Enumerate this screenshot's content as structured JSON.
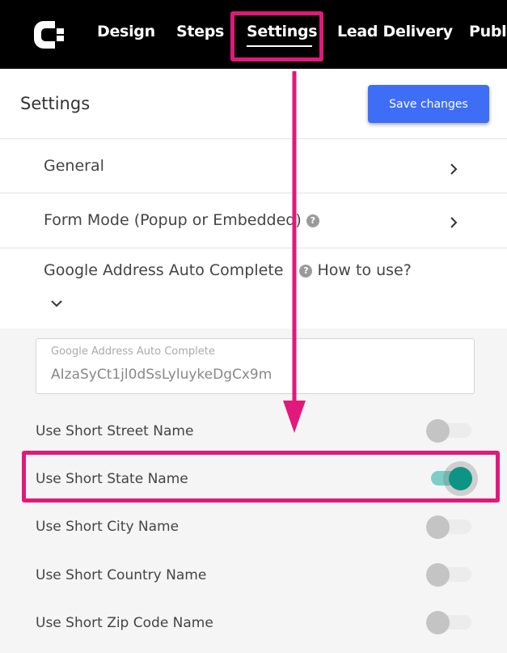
{
  "nav": {
    "items": [
      "Design",
      "Steps",
      "Settings",
      "Lead Delivery",
      "Publi"
    ],
    "active": "Settings"
  },
  "header": {
    "title": "Settings",
    "save_label": "Save changes"
  },
  "sections": [
    {
      "label": "General"
    },
    {
      "label": "Form Mode (Popup or Embedded)"
    },
    {
      "label": "Google Address Auto Complete",
      "help_link": "How to use?"
    }
  ],
  "google": {
    "field_label": "Google Address Auto Complete",
    "field_value": "AIzaSyCt1jl0dSsLyluykeDgCx9m"
  },
  "options": [
    {
      "label": "Use Short Street Name",
      "enabled": false
    },
    {
      "label": "Use Short State Name",
      "enabled": true
    },
    {
      "label": "Use Short City Name",
      "enabled": false
    },
    {
      "label": "Use Short Country Name",
      "enabled": false
    },
    {
      "label": "Use Short Zip Code Name",
      "enabled": false
    }
  ],
  "colors": {
    "accent": "#3d6ef5",
    "toggle_on": "#0e9484",
    "highlight": "#e0197a"
  },
  "icons": {
    "help": "question-mark",
    "chevron": "chevron-right / chevron-down"
  }
}
